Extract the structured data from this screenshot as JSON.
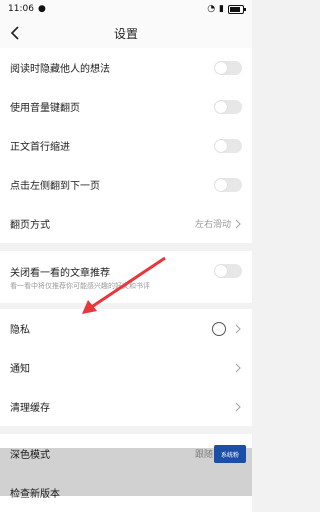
{
  "status": {
    "time": "11:06",
    "battery_level": 0.8
  },
  "header": {
    "title": "设置"
  },
  "group1": [
    {
      "label": "阅读时隐藏他人的想法"
    },
    {
      "label": "使用音量键翻页"
    },
    {
      "label": "正文首行缩进"
    },
    {
      "label": "点击左侧翻到下一页"
    },
    {
      "label": "翻页方式",
      "value": "左右滑动"
    }
  ],
  "recommend": {
    "label": "关闭看一看的文章推荐",
    "subtext": "看一看中将仅推荐你可能感兴趣的好文和书评"
  },
  "group2": [
    {
      "label": "隐私"
    },
    {
      "label": "通知"
    },
    {
      "label": "清理缓存"
    }
  ],
  "group3": [
    {
      "label": "深色模式",
      "value": "跟随系统"
    },
    {
      "label": "检查新版本"
    }
  ],
  "watermark": "系统粉",
  "colors": {
    "arrow": "#e8363a",
    "background": "#f2f2f2"
  }
}
